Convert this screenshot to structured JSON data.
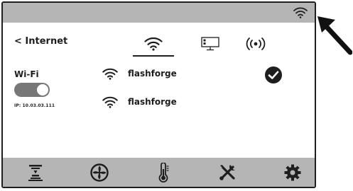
{
  "status_bar": {
    "wifi_icon": "wifi-icon",
    "background": "#b5b5b5"
  },
  "header": {
    "back_label": "< Internet"
  },
  "tabs": [
    {
      "id": "wifi",
      "icon": "wifi-icon",
      "active": true
    },
    {
      "id": "ethernet",
      "icon": "ethernet-icon",
      "active": false
    },
    {
      "id": "hotspot",
      "icon": "hotspot-icon",
      "active": false
    }
  ],
  "wifi_panel": {
    "label": "Wi-Fi",
    "toggle_on": true,
    "ip": "IP: 10.03.03.111"
  },
  "networks": [
    {
      "name": "flashforge",
      "connected": true
    },
    {
      "name": "flashforge",
      "connected": false
    }
  ],
  "bottom_nav": [
    {
      "id": "print",
      "icon": "print-job-icon"
    },
    {
      "id": "fan",
      "icon": "fan-icon"
    },
    {
      "id": "temperature",
      "icon": "thermometer-icon"
    },
    {
      "id": "tools",
      "icon": "tools-icon"
    },
    {
      "id": "settings",
      "icon": "gear-icon"
    }
  ],
  "colors": {
    "bars": "#b5b5b5",
    "text": "#1e1e1e",
    "toggle": "#777777"
  }
}
